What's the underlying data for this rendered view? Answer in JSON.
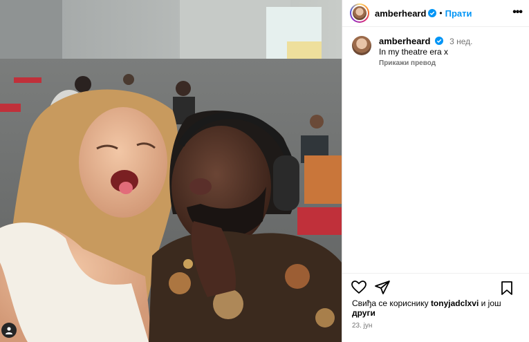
{
  "header": {
    "username": "amberheard",
    "dot": "•",
    "follow_label": "Прати",
    "more_label": "•••"
  },
  "caption": {
    "username": "amberheard",
    "time": "3 нед.",
    "text": "In my theatre era x",
    "translate_label": "Прикажи превод"
  },
  "likes": {
    "prefix": "Свиђа се кориснику",
    "user": "tonyjadclxvi",
    "middle": "и још",
    "others": "други"
  },
  "date": "23. јун",
  "icons": {
    "verified": "verified-badge-icon",
    "like": "heart-icon",
    "share": "paper-plane-icon",
    "save": "bookmark-icon",
    "tag": "user-tag-icon"
  },
  "colors": {
    "accent": "#0095f6",
    "verified": "#0095f6",
    "muted": "#737373"
  }
}
